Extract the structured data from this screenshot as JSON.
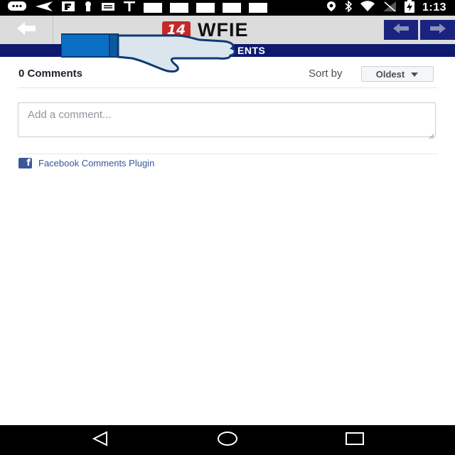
{
  "status_bar": {
    "time": "1:13",
    "left_icons": [
      "message-icon",
      "send-icon",
      "flipboard-icon",
      "keyhole-icon",
      "mail-icon",
      "text-t-icon",
      "notification-box",
      "notification-box",
      "notification-box",
      "notification-box",
      "notification-box"
    ],
    "right_icons": [
      "location-icon",
      "bluetooth-icon",
      "wifi-icon",
      "signal-off-icon",
      "battery-charging-icon"
    ]
  },
  "toolbar": {
    "logo_number": "14",
    "logo_text": "WFIE",
    "back_icon": "arrow-left-icon",
    "prev_icon": "arrow-left-icon",
    "next_icon": "arrow-right-icon",
    "colors": {
      "nav_button": "#1a237e",
      "logo_badge": "#c62828"
    }
  },
  "section": {
    "title": "ENTS"
  },
  "comments": {
    "count_label": "0 Comments",
    "sort_label": "Sort by",
    "sort_value": "Oldest",
    "input_placeholder": "Add a comment...",
    "plugin_label": "Facebook Comments Plugin",
    "plugin_icon": "facebook-icon"
  },
  "nav_bar": {
    "buttons": [
      "back-triangle-icon",
      "home-circle-icon",
      "recents-square-icon"
    ]
  }
}
